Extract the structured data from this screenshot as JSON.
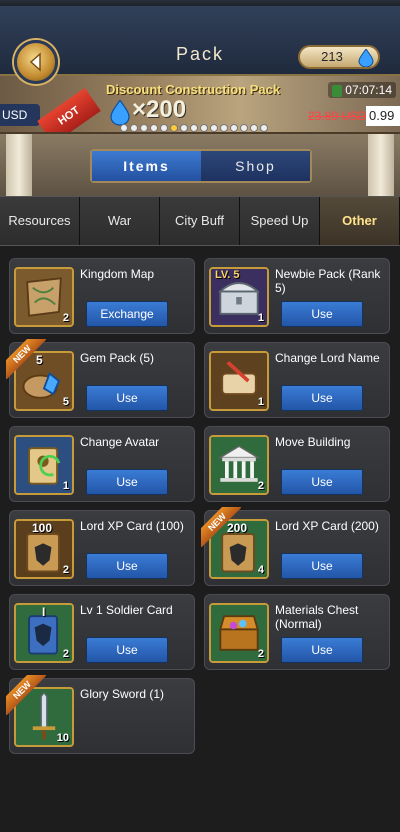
{
  "header": {
    "title": "Pack",
    "gems": "213"
  },
  "banner": {
    "title": "Discount Construction Pack",
    "amount": "×200",
    "hot_label": "HOT",
    "left_currency": "USD",
    "timer": "07:07:14",
    "old_price": "23.89 USD",
    "new_price": "0.99"
  },
  "segmented": {
    "items_label": "Items",
    "shop_label": "Shop"
  },
  "categories": [
    "Resources",
    "War",
    "City Buff",
    "Speed Up",
    "Other"
  ],
  "items": [
    {
      "name": "Kingdom Map",
      "qty": "2",
      "action": "Exchange",
      "new": false
    },
    {
      "name": "Newbie Pack (Rank 5)",
      "qty": "1",
      "action": "Use",
      "new": false,
      "badge": "LV. 5"
    },
    {
      "name": "Gem Pack (5)",
      "qty": "5",
      "action": "Use",
      "new": true,
      "badge": "5"
    },
    {
      "name": "Change Lord Name",
      "qty": "1",
      "action": "Use",
      "new": false
    },
    {
      "name": "Change Avatar",
      "qty": "1",
      "action": "Use",
      "new": false
    },
    {
      "name": "Move Building",
      "qty": "2",
      "action": "Use",
      "new": false
    },
    {
      "name": "Lord XP Card (100)",
      "qty": "2",
      "action": "Use",
      "new": false,
      "badge": "100"
    },
    {
      "name": "Lord XP Card (200)",
      "qty": "4",
      "action": "Use",
      "new": true,
      "badge": "200"
    },
    {
      "name": "Lv 1 Soldier Card",
      "qty": "2",
      "action": "Use",
      "new": false,
      "badge": "I"
    },
    {
      "name": "Materials Chest (Normal)",
      "qty": "2",
      "action": "Use",
      "new": false
    },
    {
      "name": "Glory Sword (1)",
      "qty": "10",
      "action": "",
      "new": true
    }
  ],
  "new_label": "NEW"
}
